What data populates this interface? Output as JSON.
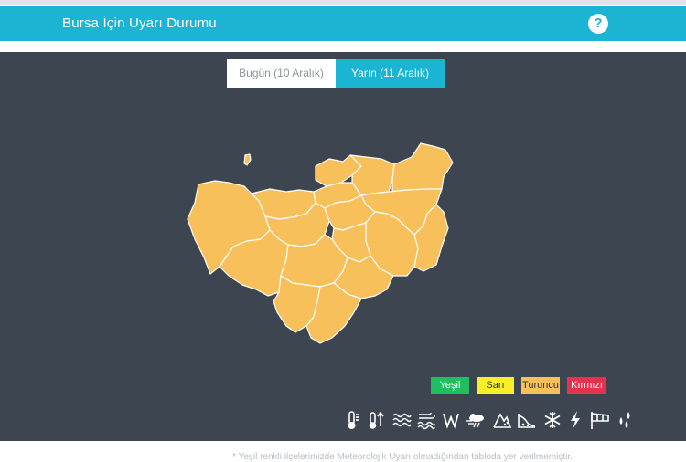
{
  "header": {
    "title": "Bursa İçin Uyarı Durumu",
    "help_label": "?"
  },
  "tabs": [
    {
      "label": "Bugün (10 Aralık)",
      "active": false
    },
    {
      "label": "Yarın (11 Aralık)",
      "active": true
    }
  ],
  "map": {
    "region_color": "#f8c05a",
    "border_color": "#ffffff"
  },
  "legend": [
    {
      "label": "Yeşil",
      "color": "#1fbf5f"
    },
    {
      "label": "Sarı",
      "color": "#f8ee2a"
    },
    {
      "label": "Turuncu",
      "color": "#f8c05a"
    },
    {
      "label": "Kırmızı",
      "color": "#e3334f"
    }
  ],
  "warning_icons": [
    "temperature-icon",
    "heat-icon",
    "wave-icon",
    "wind-sea-icon",
    "strong-wind-icon",
    "storm-icon",
    "avalanche-icon",
    "landslide-icon",
    "snow-icon",
    "lightning-icon",
    "gale-flag-icon",
    "rain-icon"
  ],
  "footer": {
    "note": "* Yeşil renkli ilçelerimizde Meteorolojik Uyarı olmadığından tabloda yer verilmemiştir."
  },
  "colors": {
    "accent": "#1bb4d3",
    "panel_bg": "#3d4650"
  }
}
